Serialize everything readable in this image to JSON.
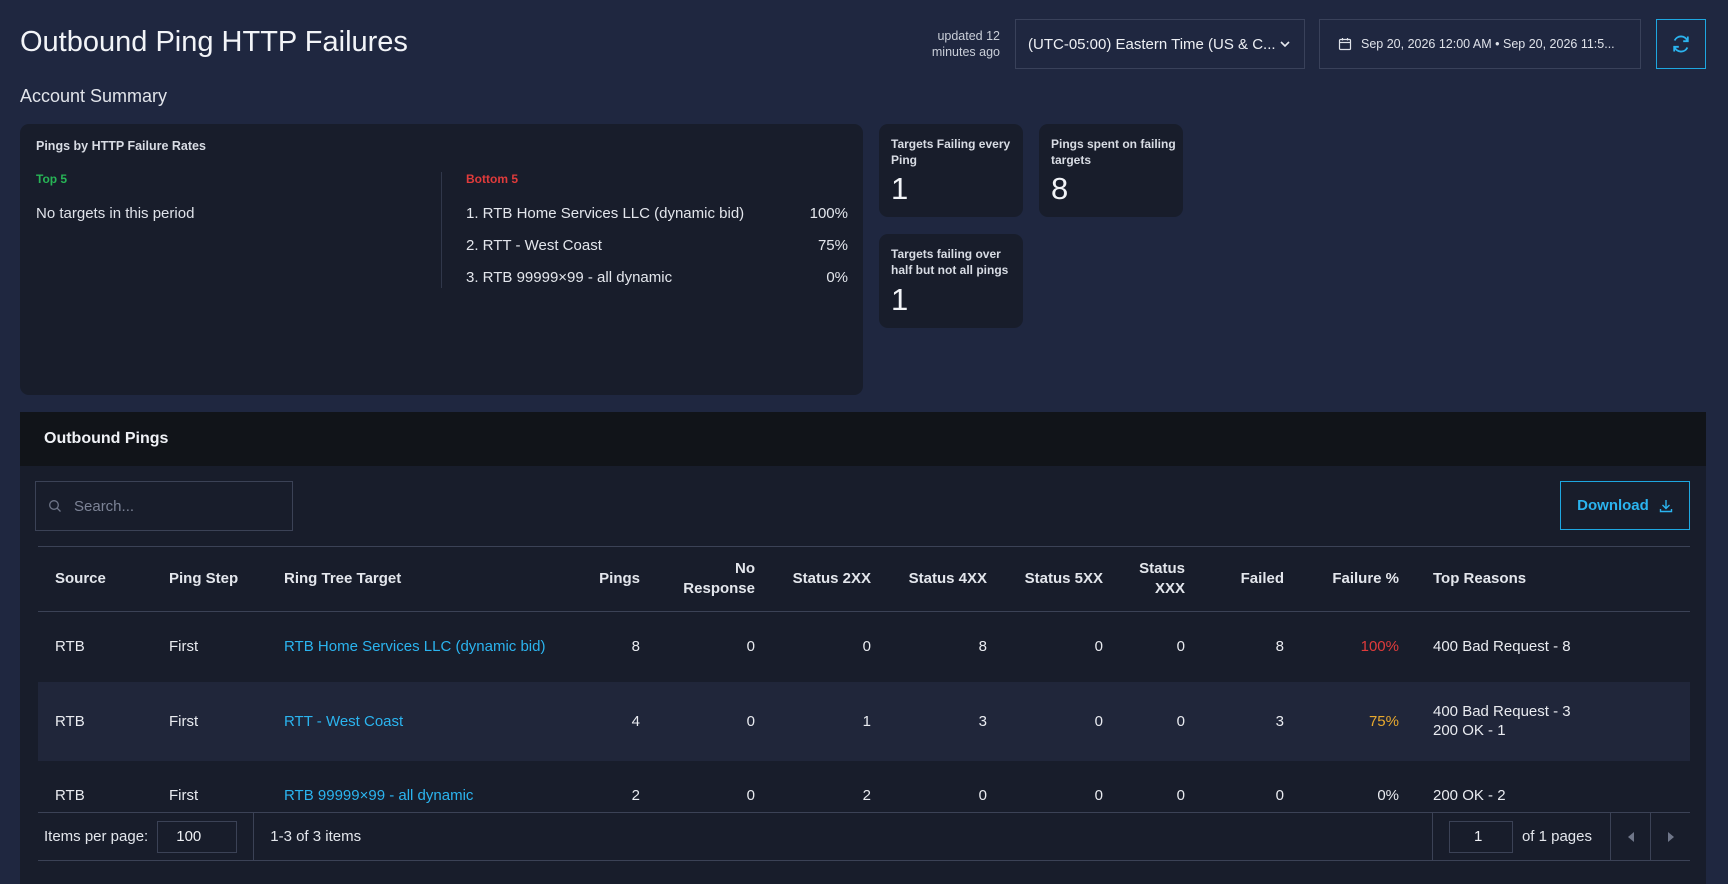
{
  "header": {
    "title": "Outbound Ping HTTP Failures",
    "updated_line1": "updated 12",
    "updated_line2": "minutes ago",
    "timezone_value": "(UTC-05:00) Eastern Time (US & C...",
    "date_range": "Sep 20, 2026 12:00 AM • Sep 20, 2026 11:5...",
    "refresh_icon": "refresh-icon"
  },
  "summary": {
    "title": "Account Summary",
    "failure_card": {
      "title": "Pings by HTTP Failure Rates",
      "top_label": "Top 5",
      "top_empty": "No targets in this period",
      "bottom_label": "Bottom 5",
      "bottom_items": [
        {
          "name": "1. RTB Home Services LLC (dynamic bid)",
          "pct": "100%"
        },
        {
          "name": "2. RTT - West Coast",
          "pct": "75%"
        },
        {
          "name": "3. RTB 99999×99 - all dynamic",
          "pct": "0%"
        }
      ]
    },
    "kpis": [
      {
        "label": "Targets Failing every Ping",
        "value": "1"
      },
      {
        "label": "Pings spent on failing targets",
        "value": "8"
      },
      {
        "label": "Targets failing over half but not all pings",
        "value": "1"
      }
    ]
  },
  "pings": {
    "title": "Outbound Pings",
    "search_placeholder": "Search...",
    "download_label": "Download",
    "columns": {
      "source": "Source",
      "ping_step": "Ping Step",
      "target": "Ring Tree Target",
      "pings": "Pings",
      "no_response_1": "No",
      "no_response_2": "Response",
      "s2xx": "Status 2XX",
      "s4xx": "Status 4XX",
      "s5xx": "Status 5XX",
      "sxxx_1": "Status",
      "sxxx_2": "XXX",
      "failed": "Failed",
      "failure_pct": "Failure %",
      "top_reasons": "Top Reasons"
    },
    "rows": [
      {
        "source": "RTB",
        "step": "First",
        "target": "RTB Home Services LLC (dynamic bid)",
        "pings": "8",
        "no_response": "0",
        "s2xx": "0",
        "s4xx": "8",
        "s5xx": "0",
        "sxxx": "0",
        "failed": "8",
        "failure_pct": "100%",
        "reason1": "400 Bad Request - 8",
        "reason2": ""
      },
      {
        "source": "RTB",
        "step": "First",
        "target": "RTT - West Coast",
        "pings": "4",
        "no_response": "0",
        "s2xx": "1",
        "s4xx": "3",
        "s5xx": "0",
        "sxxx": "0",
        "failed": "3",
        "failure_pct": "75%",
        "reason1": "400 Bad Request - 3",
        "reason2": "200 OK - 1"
      },
      {
        "source": "RTB",
        "step": "First",
        "target": "RTB 99999×99 - all dynamic",
        "pings": "2",
        "no_response": "0",
        "s2xx": "2",
        "s4xx": "0",
        "s5xx": "0",
        "sxxx": "0",
        "failed": "0",
        "failure_pct": "0%",
        "reason1": "200 OK - 2",
        "reason2": ""
      }
    ],
    "footer": {
      "items_per_page_label": "Items per page:",
      "items_per_page_value": "100",
      "range_text": "1-3 of 3 items",
      "page_value": "1",
      "of_pages": "of 1 pages"
    }
  },
  "colors": {
    "background": "#1f2740",
    "card": "#181d2b",
    "accent": "#1ea7e0",
    "top_green": "#27b556",
    "bottom_red": "#e03b3b",
    "warning_amber": "#e8a92e"
  }
}
